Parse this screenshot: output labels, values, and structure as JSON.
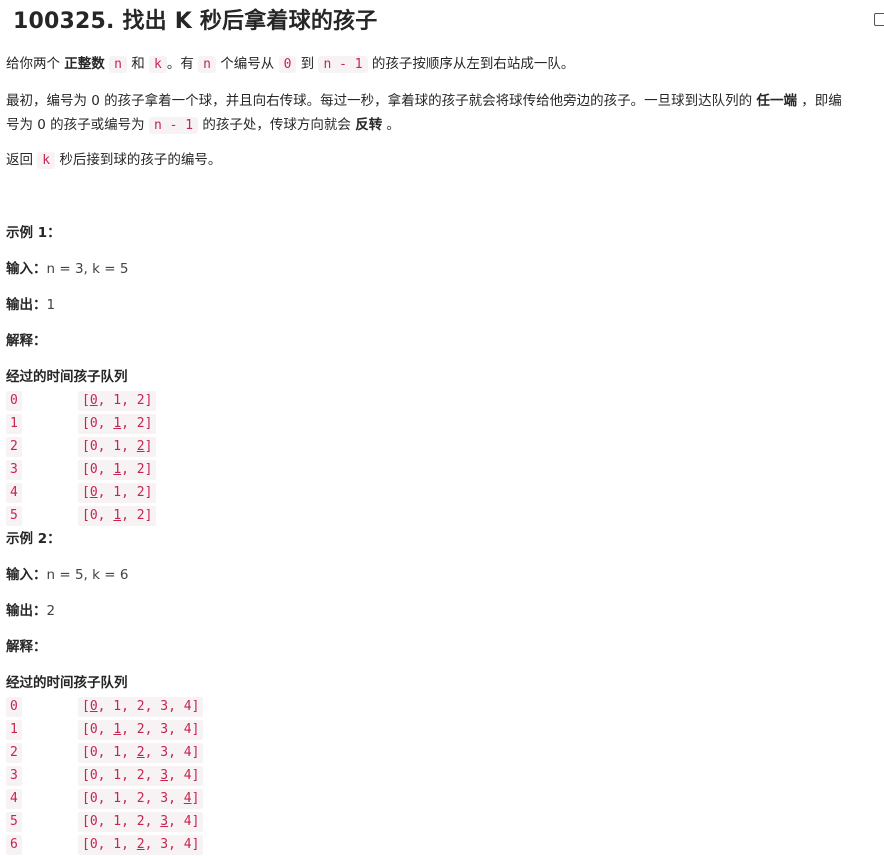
{
  "problem": {
    "title": "100325. 找出 K 秒后拿着球的孩子",
    "para1": {
      "t1": "给你两个 ",
      "b1": "正整数",
      "c1": "n",
      "t2": " 和 ",
      "c2": "k",
      "t3": "。有 ",
      "c3": "n",
      "t4": " 个编号从 ",
      "c4": "0",
      "t5": " 到 ",
      "c5": "n - 1",
      "t6": " 的孩子按顺序从左到右站成一队。"
    },
    "para2": {
      "t1": "最初，编号为 0 的孩子拿着一个球，并且向右传球。每过一秒，拿着球的孩子就会将球传给他旁边的孩子。一旦球到达队列的 ",
      "b1": "任一端",
      "t2": " ，即编",
      "t3": "号为 0 的孩子或编号为 ",
      "c1": "n - 1",
      "t4": " 的孩子处，传球方向就会 ",
      "b2": "反转",
      "t5": " 。"
    },
    "para3": {
      "t1": "返回 ",
      "c1": "k",
      "t2": " 秒后接到球的孩子的编号。"
    }
  },
  "examples": [
    {
      "heading": "示例 1：",
      "input_label": "输入：",
      "input_value": "n = 3, k = 5",
      "output_label": "输出：",
      "output_value": "1",
      "explain_label": "解释：",
      "table_header": "经过的时间孩子队列",
      "rows": [
        {
          "time": "0",
          "pre": "[",
          "hl": "0",
          "post": ", 1, 2]"
        },
        {
          "time": "1",
          "pre": "[0, ",
          "hl": "1",
          "post": ", 2]"
        },
        {
          "time": "2",
          "pre": "[0, 1, ",
          "hl": "2",
          "post": "]"
        },
        {
          "time": "3",
          "pre": "[0, ",
          "hl": "1",
          "post": ", 2]"
        },
        {
          "time": "4",
          "pre": "[",
          "hl": "0",
          "post": ", 1, 2]"
        },
        {
          "time": "5",
          "pre": "[0, ",
          "hl": "1",
          "post": ", 2]"
        }
      ]
    },
    {
      "heading": "示例 2：",
      "input_label": "输入：",
      "input_value": "n = 5, k = 6",
      "output_label": "输出：",
      "output_value": "2",
      "explain_label": "解释：",
      "table_header": "经过的时间孩子队列",
      "rows": [
        {
          "time": "0",
          "pre": "[",
          "hl": "0",
          "post": ", 1, 2, 3, 4]"
        },
        {
          "time": "1",
          "pre": "[0, ",
          "hl": "1",
          "post": ", 2, 3, 4]"
        },
        {
          "time": "2",
          "pre": "[0, 1, ",
          "hl": "2",
          "post": ", 3, 4]"
        },
        {
          "time": "3",
          "pre": "[0, 1, 2, ",
          "hl": "3",
          "post": ", 4]"
        },
        {
          "time": "4",
          "pre": "[0, 1, 2, 3, ",
          "hl": "4",
          "post": "]"
        },
        {
          "time": "5",
          "pre": "[0, 1, 2, ",
          "hl": "3",
          "post": ", 4]"
        },
        {
          "time": "6",
          "pre": "[0, 1, ",
          "hl": "2",
          "post": ", 3, 4]"
        }
      ]
    }
  ],
  "colors": {
    "code_text": "#c7254e",
    "code_bg": "#f7f2f4",
    "text": "#262626"
  }
}
